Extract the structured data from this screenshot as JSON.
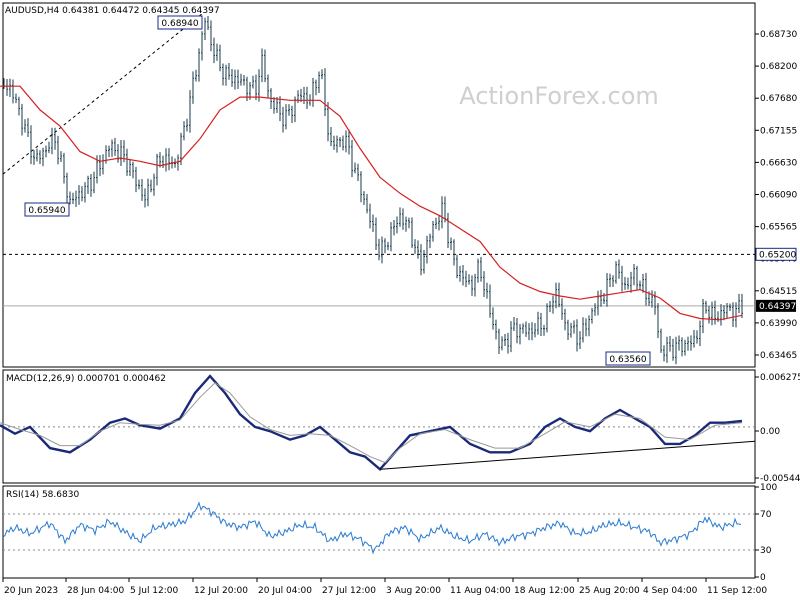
{
  "watermark": "ActionForex.com",
  "chart_data": [
    {
      "type": "candlestick",
      "title": "AUDUSD,H4 0.64381 0.64472 0.64345 0.64397",
      "ylim": [
        0.6346,
        0.691
      ],
      "yticks": [
        "0.68730",
        "0.68200",
        "0.67680",
        "0.67155",
        "0.66630",
        "0.66090",
        "0.65565",
        "0.65040",
        "0.64515",
        "0.63990",
        "0.63465"
      ],
      "current_price": "0.64397",
      "resistance_level": "0.65200",
      "annotations": [
        "0.68940",
        "0.65940",
        "0.63560"
      ],
      "xticks": [
        "20 Jun 2023",
        "28 Jun 04:00",
        "5 Jul 12:00",
        "12 Jul 20:00",
        "20 Jul 04:00",
        "27 Jul 12:00",
        "3 Aug 20:00",
        "11 Aug 04:00",
        "18 Aug 12:00",
        "25 Aug 20:00",
        "4 Sep 04:00",
        "11 Sep 12:00"
      ],
      "price_path": [
        [
          0,
          0.6786
        ],
        [
          10,
          0.678
        ],
        [
          20,
          0.674
        ],
        [
          35,
          0.6665
        ],
        [
          55,
          0.67
        ],
        [
          70,
          0.66
        ],
        [
          90,
          0.663
        ],
        [
          110,
          0.669
        ],
        [
          125,
          0.667
        ],
        [
          145,
          0.6605
        ],
        [
          160,
          0.667
        ],
        [
          175,
          0.666
        ],
        [
          185,
          0.672
        ],
        [
          195,
          0.68
        ],
        [
          205,
          0.6885
        ],
        [
          215,
          0.683
        ],
        [
          225,
          0.68
        ],
        [
          240,
          0.679
        ],
        [
          255,
          0.6775
        ],
        [
          262,
          0.682
        ],
        [
          270,
          0.676
        ],
        [
          285,
          0.673
        ],
        [
          300,
          0.677
        ],
        [
          310,
          0.676
        ],
        [
          320,
          0.681
        ],
        [
          330,
          0.669
        ],
        [
          345,
          0.67
        ],
        [
          355,
          0.665
        ],
        [
          365,
          0.66
        ],
        [
          380,
          0.652
        ],
        [
          400,
          0.658
        ],
        [
          410,
          0.656
        ],
        [
          420,
          0.65
        ],
        [
          432,
          0.656
        ],
        [
          443,
          0.659
        ],
        [
          455,
          0.65
        ],
        [
          470,
          0.647
        ],
        [
          480,
          0.65
        ],
        [
          490,
          0.643
        ],
        [
          500,
          0.6375
        ],
        [
          515,
          0.6405
        ],
        [
          530,
          0.64
        ],
        [
          545,
          0.6415
        ],
        [
          555,
          0.6465
        ],
        [
          565,
          0.641
        ],
        [
          580,
          0.639
        ],
        [
          595,
          0.644
        ],
        [
          605,
          0.646
        ],
        [
          615,
          0.65
        ],
        [
          625,
          0.647
        ],
        [
          635,
          0.649
        ],
        [
          645,
          0.646
        ],
        [
          655,
          0.644
        ],
        [
          660,
          0.637
        ],
        [
          675,
          0.6375
        ],
        [
          695,
          0.6385
        ],
        [
          705,
          0.644
        ],
        [
          715,
          0.642
        ],
        [
          725,
          0.6435
        ],
        [
          735,
          0.643
        ],
        [
          742,
          0.644
        ]
      ],
      "ma_path": [
        [
          0,
          0.6782
        ],
        [
          20,
          0.6782
        ],
        [
          40,
          0.6745
        ],
        [
          60,
          0.672
        ],
        [
          80,
          0.668
        ],
        [
          100,
          0.6665
        ],
        [
          120,
          0.667
        ],
        [
          140,
          0.6665
        ],
        [
          160,
          0.6658
        ],
        [
          180,
          0.6665
        ],
        [
          200,
          0.67
        ],
        [
          220,
          0.6745
        ],
        [
          240,
          0.6765
        ],
        [
          260,
          0.6765
        ],
        [
          290,
          0.676
        ],
        [
          320,
          0.676
        ],
        [
          340,
          0.6735
        ],
        [
          360,
          0.6685
        ],
        [
          380,
          0.664
        ],
        [
          400,
          0.6615
        ],
        [
          420,
          0.6595
        ],
        [
          440,
          0.658
        ],
        [
          460,
          0.656
        ],
        [
          480,
          0.654
        ],
        [
          500,
          0.65
        ],
        [
          520,
          0.6475
        ],
        [
          540,
          0.6462
        ],
        [
          560,
          0.6455
        ],
        [
          580,
          0.645
        ],
        [
          600,
          0.6455
        ],
        [
          620,
          0.646
        ],
        [
          640,
          0.6465
        ],
        [
          660,
          0.6452
        ],
        [
          680,
          0.6428
        ],
        [
          700,
          0.642
        ],
        [
          720,
          0.6418
        ],
        [
          742,
          0.6425
        ]
      ]
    },
    {
      "type": "line",
      "title": "MACD(12,26,9) 0.000701 0.000462",
      "ylim": [
        -0.0065,
        0.0066
      ],
      "yticks": [
        "0.006275",
        "0.00",
        "-0.005446"
      ],
      "series": [
        {
          "role": "macd",
          "points": [
            [
              0,
              0.0002
            ],
            [
              15,
              -0.0008
            ],
            [
              30,
              0.0
            ],
            [
              50,
              -0.0025
            ],
            [
              70,
              -0.003
            ],
            [
              90,
              -0.0015
            ],
            [
              110,
              0.0005
            ],
            [
              125,
              0.001
            ],
            [
              140,
              0.0002
            ],
            [
              160,
              -0.0002
            ],
            [
              180,
              0.001
            ],
            [
              195,
              0.004
            ],
            [
              210,
              0.006
            ],
            [
              225,
              0.004
            ],
            [
              240,
              0.0015
            ],
            [
              255,
              0.0
            ],
            [
              270,
              -0.0005
            ],
            [
              290,
              -0.0015
            ],
            [
              305,
              -0.001
            ],
            [
              320,
              0.0
            ],
            [
              335,
              -0.0015
            ],
            [
              350,
              -0.003
            ],
            [
              365,
              -0.0035
            ],
            [
              380,
              -0.005
            ],
            [
              395,
              -0.003
            ],
            [
              410,
              -0.001
            ],
            [
              430,
              -0.0005
            ],
            [
              450,
              0.0
            ],
            [
              470,
              -0.002
            ],
            [
              490,
              -0.003
            ],
            [
              510,
              -0.003
            ],
            [
              530,
              -0.002
            ],
            [
              545,
              0.0
            ],
            [
              560,
              0.001
            ],
            [
              575,
              0.0
            ],
            [
              590,
              -0.0005
            ],
            [
              605,
              0.001
            ],
            [
              620,
              0.002
            ],
            [
              635,
              0.001
            ],
            [
              650,
              0.0
            ],
            [
              665,
              -0.002
            ],
            [
              680,
              -0.002
            ],
            [
              695,
              -0.001
            ],
            [
              710,
              0.0005
            ],
            [
              725,
              0.0005
            ],
            [
              742,
              0.0007
            ]
          ]
        },
        {
          "role": "signal",
          "points": [
            [
              0,
              0.0005
            ],
            [
              20,
              -0.0003
            ],
            [
              40,
              -0.001
            ],
            [
              60,
              -0.0022
            ],
            [
              80,
              -0.0022
            ],
            [
              100,
              -0.0005
            ],
            [
              120,
              0.0005
            ],
            [
              140,
              0.0003
            ],
            [
              160,
              0.0002
            ],
            [
              180,
              0.0008
            ],
            [
              200,
              0.0035
            ],
            [
              215,
              0.0052
            ],
            [
              230,
              0.004
            ],
            [
              250,
              0.0012
            ],
            [
              270,
              -0.0003
            ],
            [
              290,
              -0.001
            ],
            [
              310,
              -0.0008
            ],
            [
              330,
              -0.001
            ],
            [
              350,
              -0.0022
            ],
            [
              370,
              -0.0035
            ],
            [
              385,
              -0.0042
            ],
            [
              400,
              -0.0025
            ],
            [
              420,
              -0.0008
            ],
            [
              445,
              -0.0003
            ],
            [
              470,
              -0.0015
            ],
            [
              495,
              -0.0025
            ],
            [
              520,
              -0.0025
            ],
            [
              545,
              -0.0008
            ],
            [
              565,
              0.0006
            ],
            [
              590,
              0.0
            ],
            [
              615,
              0.0015
            ],
            [
              640,
              0.001
            ],
            [
              665,
              -0.0012
            ],
            [
              690,
              -0.0015
            ],
            [
              715,
              0.0002
            ],
            [
              742,
              0.0005
            ]
          ]
        },
        {
          "role": "trendline",
          "points": [
            [
              380,
              -0.005
            ],
            [
              755,
              -0.0017
            ]
          ]
        }
      ]
    },
    {
      "type": "line",
      "title": "RSI(14) 58.6830",
      "ylim": [
        0,
        100
      ],
      "yticks": [
        "100",
        "70",
        "30",
        "0"
      ],
      "series": [
        {
          "role": "rsi",
          "points": [
            [
              0,
              45
            ],
            [
              15,
              55
            ],
            [
              30,
              48
            ],
            [
              50,
              60
            ],
            [
              65,
              40
            ],
            [
              80,
              58
            ],
            [
              95,
              52
            ],
            [
              110,
              62
            ],
            [
              125,
              50
            ],
            [
              140,
              40
            ],
            [
              155,
              55
            ],
            [
              170,
              58
            ],
            [
              185,
              62
            ],
            [
              200,
              80
            ],
            [
              212,
              72
            ],
            [
              225,
              60
            ],
            [
              240,
              55
            ],
            [
              255,
              62
            ],
            [
              270,
              45
            ],
            [
              285,
              50
            ],
            [
              300,
              58
            ],
            [
              315,
              55
            ],
            [
              330,
              40
            ],
            [
              345,
              48
            ],
            [
              360,
              42
            ],
            [
              375,
              30
            ],
            [
              390,
              50
            ],
            [
              405,
              55
            ],
            [
              420,
              42
            ],
            [
              440,
              55
            ],
            [
              455,
              45
            ],
            [
              470,
              40
            ],
            [
              485,
              48
            ],
            [
              500,
              38
            ],
            [
              515,
              45
            ],
            [
              530,
              48
            ],
            [
              545,
              55
            ],
            [
              560,
              60
            ],
            [
              575,
              48
            ],
            [
              590,
              50
            ],
            [
              605,
              58
            ],
            [
              620,
              60
            ],
            [
              635,
              55
            ],
            [
              650,
              50
            ],
            [
              660,
              38
            ],
            [
              675,
              42
            ],
            [
              690,
              48
            ],
            [
              705,
              65
            ],
            [
              720,
              55
            ],
            [
              735,
              60
            ],
            [
              742,
              58.7
            ]
          ]
        }
      ]
    }
  ]
}
